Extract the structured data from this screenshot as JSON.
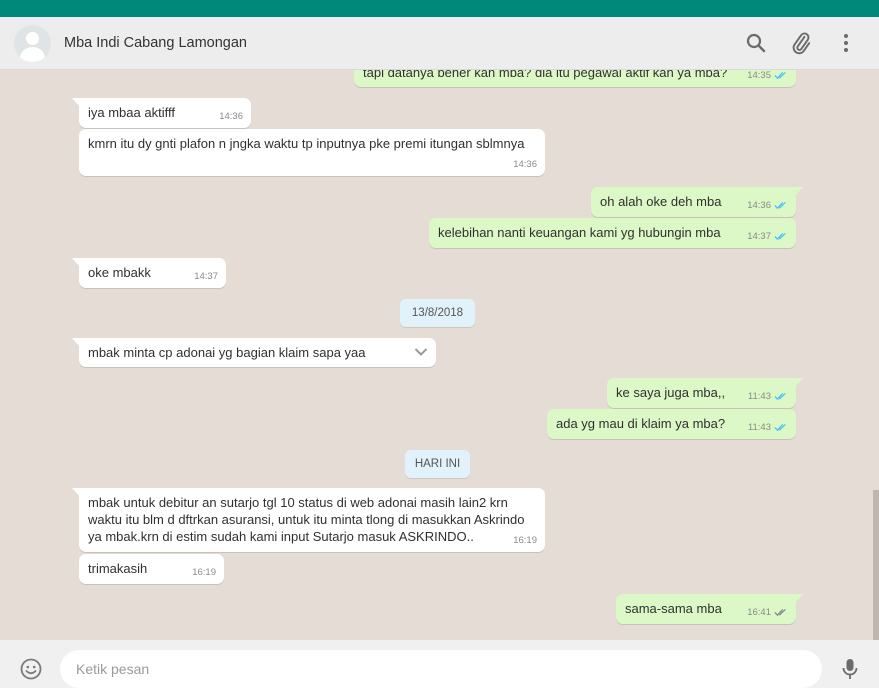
{
  "header": {
    "contact_name": "Mba Indi Cabang Lamongan",
    "icons": [
      "search-icon",
      "attach-icon",
      "menu-icon"
    ]
  },
  "messages": [
    {
      "text": "tapi datanya bener kan mba? dia itu pegawai aktif kan ya mba?",
      "time": "14:35",
      "direction": "out",
      "status": "read"
    },
    {
      "text": "iya mbaa aktifff",
      "time": "14:36",
      "direction": "in"
    },
    {
      "text": "kmrn itu dy gnti plafon n jngka waktu tp inputnya pke premi itungan sblmnya",
      "time": "14:36",
      "direction": "in"
    },
    {
      "text": "oh alah oke deh mba",
      "time": "14:36",
      "direction": "out",
      "status": "read"
    },
    {
      "text": "kelebihan nanti keuangan kami yg hubungin mba",
      "time": "14:37",
      "direction": "out",
      "status": "read"
    },
    {
      "text": "oke mbakk",
      "time": "14:37",
      "direction": "in"
    },
    {
      "text": "mbak minta cp adonai yg bagian klaim sapa yaa",
      "time": "",
      "direction": "in"
    },
    {
      "text": "ke saya juga mba,,",
      "time": "11:43",
      "direction": "out",
      "status": "read"
    },
    {
      "text": "ada yg mau di klaim ya mba?",
      "time": "11:43",
      "direction": "out",
      "status": "read"
    },
    {
      "text": "mbak untuk debitur an sutarjo tgl 10 status di web adonai masih lain2 krn waktu itu blm d dftrkan asuransi, untuk itu minta tlong di masukkan Askrindo ya mbak.krn di estim sudah kami input Sutarjo masuk ASKRINDO..",
      "time": "16:19",
      "direction": "in"
    },
    {
      "text": "trimakasih",
      "time": "16:19",
      "direction": "in"
    },
    {
      "text": "sama-sama mba",
      "time": "16:41",
      "direction": "out",
      "status": "delivered"
    }
  ],
  "date_chips": [
    "13/8/2018",
    "HARI INI"
  ],
  "composer": {
    "placeholder": "Ketik pesan",
    "icons": [
      "emoji-icon",
      "microphone-icon"
    ]
  },
  "colors": {
    "brand": "#00897b",
    "chat_background": "#e5ddd5",
    "outgoing_bubble": "#dcf8c6",
    "incoming_bubble": "#ffffff",
    "read_tick": "#4fc3f7",
    "delivered_tick": "#8a8a8a",
    "date_chip": "#e1f2fb"
  }
}
